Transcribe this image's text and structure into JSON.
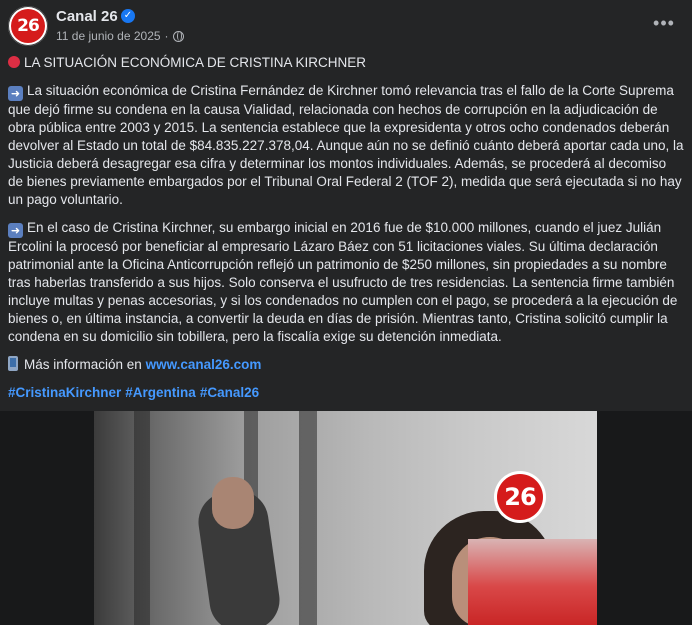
{
  "post": {
    "page_name": "Canal 26",
    "avatar_text": "26",
    "date": "11 de junio de 2025",
    "privacy_icon": "globe-icon",
    "more_label": "•••"
  },
  "content": {
    "headline": "LA SITUACIÓN ECONÓMICA DE CRISTINA KIRCHNER",
    "paragraph1": "La situación económica de Cristina Fernández de Kirchner tomó relevancia tras el fallo de la Corte Suprema que dejó firme su condena en la causa Vialidad, relacionada con hechos de corrupción en la adjudicación de obra pública entre 2003 y 2015. La sentencia establece que la expresidenta y otros ocho condenados deberán devolver al Estado un total de $84.835.227.378,04. Aunque aún no se definió cuánto deberá aportar cada uno, la Justicia deberá desagregar esa cifra y determinar los montos individuales. Además, se procederá al decomiso de bienes previamente embargados por el Tribunal Oral Federal 2 (TOF 2), medida que será ejecutada si no hay un pago voluntario.",
    "paragraph2": "En el caso de Cristina Kirchner, su embargo inicial en 2016 fue de $10.000 millones, cuando el juez Julián Ercolini la procesó por beneficiar al empresario Lázaro Báez con 51 licitaciones viales. Su última declaración patrimonial ante la Oficina Anticorrupción reflejó un patrimonio de $250 millones, sin propiedades a su nombre tras haberlas transferido a sus hijos. Solo conserva el usufructo de tres residencias. La sentencia firme también incluye multas y penas accesorias, y si los condenados no cumplen con el pago, se procederá a la ejecución de bienes o, en última instancia, a convertir la deuda en días de prisión. Mientras tanto, Cristina solicitó cumplir la condena en su domicilio sin tobillera, pero la fiscalía exige su detención inmediata.",
    "more_info_label": "Más información en",
    "more_info_link": "www.canal26.com",
    "hashtags": [
      "#CristinaKirchner",
      "#Argentina",
      "#Canal26"
    ]
  },
  "image": {
    "logo_text": "26"
  },
  "colors": {
    "background": "#242526",
    "text": "#e4e6eb",
    "secondary_text": "#b0b3b8",
    "link": "#4599ff",
    "brand_red": "#d51b1b"
  }
}
